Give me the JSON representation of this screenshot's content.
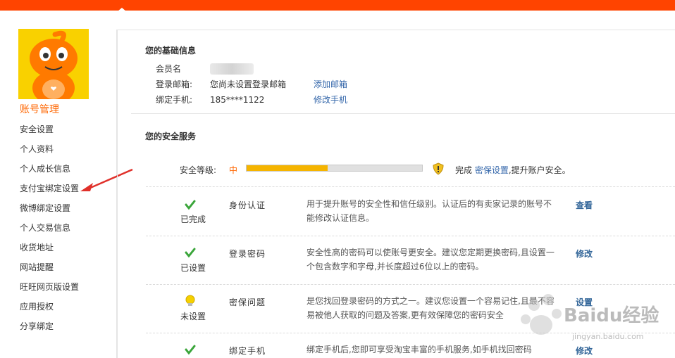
{
  "sidebar": {
    "title": "账号管理",
    "items": [
      {
        "label": "安全设置"
      },
      {
        "label": "个人资料"
      },
      {
        "label": "个人成长信息"
      },
      {
        "label": "支付宝绑定设置"
      },
      {
        "label": "微博绑定设置"
      },
      {
        "label": "个人交易信息"
      },
      {
        "label": "收货地址"
      },
      {
        "label": "网站提醒"
      },
      {
        "label": "旺旺网页版设置"
      },
      {
        "label": "应用授权"
      },
      {
        "label": "分享绑定"
      }
    ]
  },
  "basic_info": {
    "title": "您的基础信息",
    "member_label": "会员名",
    "email_label": "登录邮箱:",
    "email_value": "您尚未设置登录邮箱",
    "email_action": "添加邮箱",
    "phone_label": "绑定手机:",
    "phone_value": "185****1122",
    "phone_action": "修改手机"
  },
  "security": {
    "title": "您的安全服务",
    "level_label": "安全等级:",
    "level_value": "中",
    "level_fraction": 0.46,
    "hint_prefix": "完成",
    "hint_link": "密保设置",
    "hint_suffix": ",提升账户安全。",
    "services": [
      {
        "status": "已完成",
        "icon": "check-icon",
        "name": "身份认证",
        "desc": "用于提升账号的安全性和信任级别。认证后的有卖家记录的账号不能修改认证信息。",
        "action": "查看"
      },
      {
        "status": "已设置",
        "icon": "check-icon",
        "name": "登录密码",
        "desc": "安全性高的密码可以使账号更安全。建议您定期更换密码,且设置一个包含数字和字母,并长度超过6位以上的密码。",
        "action": "修改"
      },
      {
        "status": "未设置",
        "icon": "lightbulb-icon",
        "name": "密保问题",
        "desc": "是您找回登录密码的方式之一。建议您设置一个容易记住,且最不容易被他人获取的问题及答案,更有效保障您的密码安全",
        "action": "设置"
      },
      {
        "status": "",
        "icon": "check-icon",
        "name": "绑定手机",
        "desc": "绑定手机后,您即可享受淘宝丰富的手机服务,如手机找回密码",
        "action": "修改"
      }
    ]
  },
  "watermark": {
    "text": "Baidu经验",
    "sub": "jingyan.baidu.com"
  },
  "colors": {
    "accent": "#ff4400",
    "link": "#3366aa",
    "progress": "#f5b400"
  }
}
